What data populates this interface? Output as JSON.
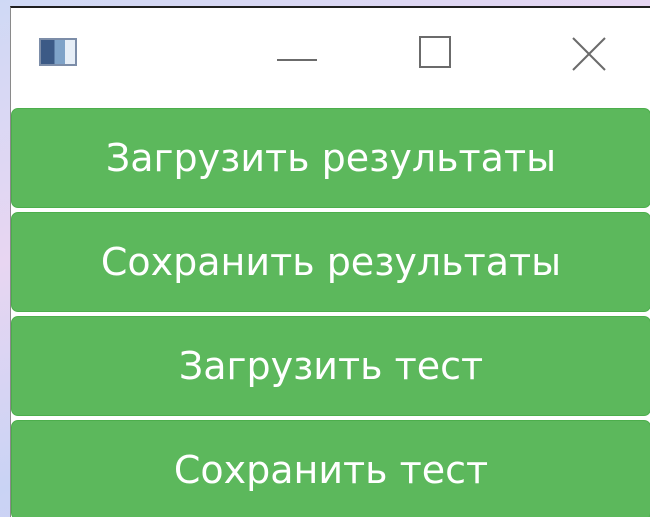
{
  "window": {
    "title_icon": "app-window-icon",
    "controls": {
      "minimize_icon": "minimize-icon",
      "maximize_icon": "maximize-icon",
      "close_icon": "close-icon"
    }
  },
  "colors": {
    "button_bg": "#5cb85c",
    "button_text": "#ffffff",
    "titlebar_bg": "#ffffff"
  },
  "buttons": [
    {
      "label": "Загрузить результаты"
    },
    {
      "label": "Сохранить результаты"
    },
    {
      "label": "Загрузить тест"
    },
    {
      "label": "Сохранить тест"
    }
  ]
}
